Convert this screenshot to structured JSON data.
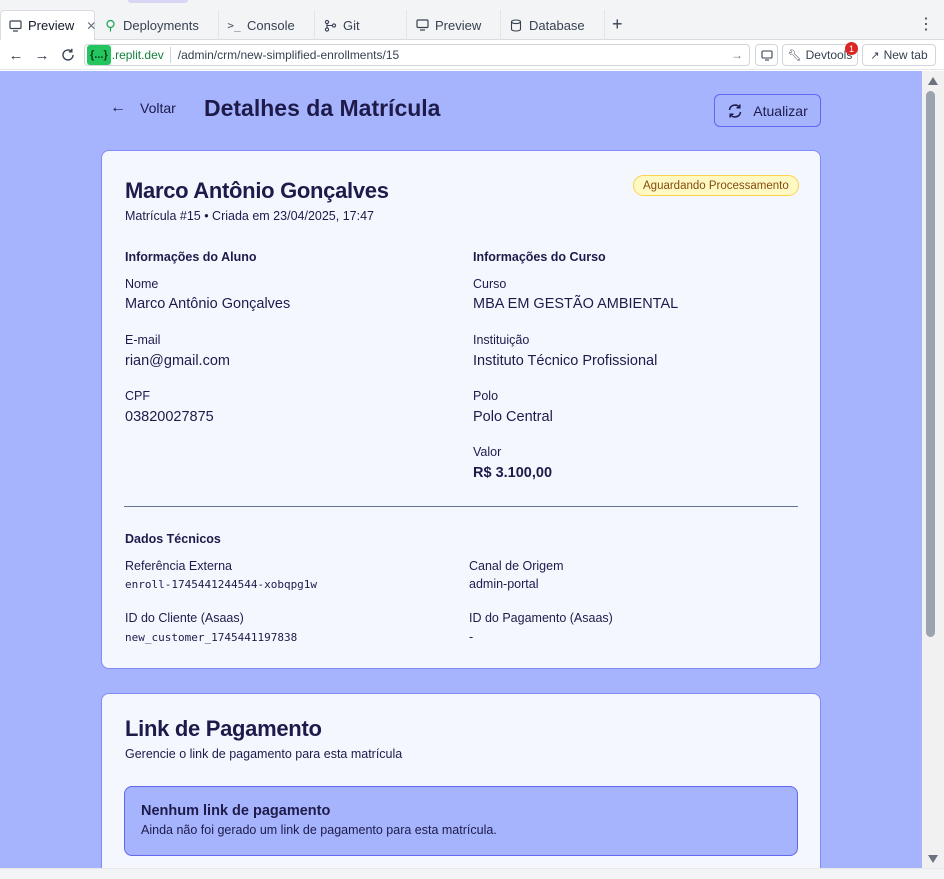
{
  "browser": {
    "tabs": [
      {
        "label": "Preview",
        "icon": "monitor-icon",
        "active": true
      },
      {
        "label": "Deployments",
        "icon": "deploy-icon"
      },
      {
        "label": "Console",
        "icon": "terminal-icon"
      },
      {
        "label": "Git",
        "icon": "git-branch-icon"
      },
      {
        "label": "Preview",
        "icon": "monitor-icon"
      },
      {
        "label": "Database",
        "icon": "database-icon"
      }
    ],
    "new_tab_symbol": "+",
    "menu_symbol": "⋮",
    "url": {
      "domain_chip": "{...}",
      "domain": ".replit.dev",
      "path": "/admin/crm/new-simplified-enrollments/15"
    },
    "devtools_label": "Devtools",
    "devtools_badge": "1",
    "new_tab_label": "New tab"
  },
  "page": {
    "back_label": "Voltar",
    "title": "Detalhes da Matrícula",
    "refresh_label": "Atualizar"
  },
  "enrollment": {
    "student_name": "Marco Antônio Gonçalves",
    "subtitle": "Matrícula #15 • Criada em 23/04/2025, 17:47",
    "status": "Aguardando Processamento",
    "student_section": {
      "heading": "Informações do Aluno",
      "fields": [
        {
          "label": "Nome",
          "value": "Marco Antônio Gonçalves"
        },
        {
          "label": "E-mail",
          "value": "rian@gmail.com"
        },
        {
          "label": "CPF",
          "value": "03820027875"
        }
      ]
    },
    "course_section": {
      "heading": "Informações do Curso",
      "fields": [
        {
          "label": "Curso",
          "value": "MBA EM GESTÃO AMBIENTAL"
        },
        {
          "label": "Instituição",
          "value": "Instituto Técnico Profissional"
        },
        {
          "label": "Polo",
          "value": "Polo Central"
        },
        {
          "label": "Valor",
          "value": "R$ 3.100,00"
        }
      ]
    },
    "technical": {
      "heading": "Dados Técnicos",
      "fields": [
        {
          "label": "Referência Externa",
          "value": "enroll-1745441244544-xobqpg1w"
        },
        {
          "label": "Canal de Origem",
          "value": "admin-portal"
        },
        {
          "label": "ID do Cliente (Asaas)",
          "value": "new_customer_1745441197838"
        },
        {
          "label": "ID do Pagamento (Asaas)",
          "value": "-"
        }
      ]
    }
  },
  "payment": {
    "title": "Link de Pagamento",
    "subtitle": "Gerencie o link de pagamento para esta matrícula",
    "notice_title": "Nenhum link de pagamento",
    "notice_text": "Ainda não foi gerado um link de pagamento para esta matrícula."
  },
  "colors": {
    "page_background": "#a5b4fc",
    "card_background": "#f5f7ff",
    "accent": "#6366f1",
    "text": "#1e1b4b",
    "status_badge_bg": "#fef9c3",
    "status_badge_text": "#854d0e"
  }
}
